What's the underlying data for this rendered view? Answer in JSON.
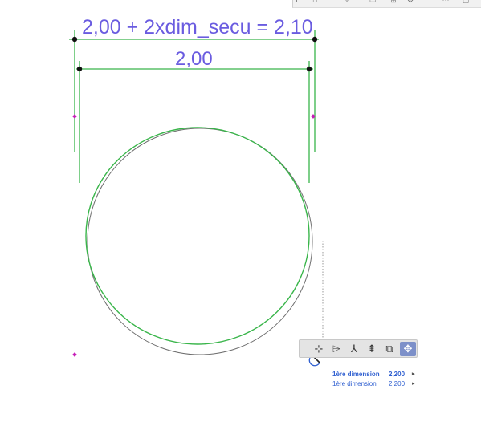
{
  "dimensions": {
    "outer_label": "2,00 + 2xdim_secu = 2,10",
    "inner_label": "2,00"
  },
  "colors": {
    "dimension_line": "#39b54a",
    "dimension_text": "#6a5ce0",
    "node_point": "#c61fb8",
    "active_tool": "#7d90c9",
    "tracker_text": "#2f5fd0"
  },
  "top_toolbar": {
    "icons": [
      "menu-glyph-icon",
      "page-icon",
      "pointer-icon",
      "folder-icon",
      "document-icon",
      "grid-icon",
      "settings-icon",
      "more-icon",
      "window-icon"
    ],
    "left_glyph": "E"
  },
  "pet_palette": {
    "tools": [
      {
        "icon": "move-node-icon",
        "glyph": "⊹",
        "active": false
      },
      {
        "icon": "offset-edge-icon",
        "glyph": "⌲",
        "active": false
      },
      {
        "icon": "split-icon",
        "glyph": "⅄",
        "active": false
      },
      {
        "icon": "stretch-icon",
        "glyph": "⇞",
        "active": false
      },
      {
        "icon": "copy-icon",
        "glyph": "⧉",
        "active": false
      },
      {
        "icon": "drag-icon",
        "glyph": "✥",
        "active": true
      }
    ]
  },
  "tracker": {
    "rows": [
      {
        "label": "1ère dimension",
        "value": "2,200",
        "arrow": "▸"
      },
      {
        "label": "1ère dimension",
        "value": "2,200",
        "arrow": "▸"
      }
    ]
  }
}
